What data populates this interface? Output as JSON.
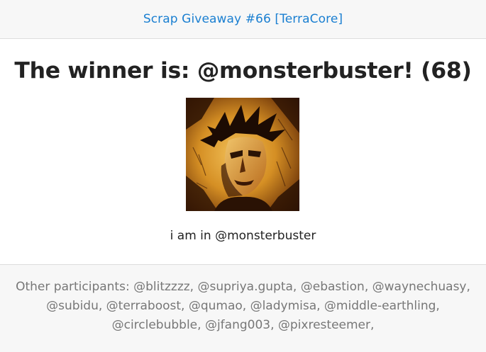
{
  "header": {
    "title_link": "Scrap Giveaway #66 [TerraCore]"
  },
  "main": {
    "winner_text": "The winner is: @monsterbuster! (68)",
    "avatar_icon": "winner-avatar-image",
    "comment": "i am in @monsterbuster"
  },
  "footer": {
    "participants_text": "Other participants: @blitzzzz, @supriya.gupta, @ebastion, @waynechuasy, @subidu, @terraboost, @qumao, @ladymisa, @middle-earthling, @circlebubble, @jfang003, @pixresteemer,"
  },
  "colors": {
    "link": "#1a7fd1",
    "text": "#222222",
    "muted": "#777777",
    "band_bg": "#f7f7f7"
  }
}
